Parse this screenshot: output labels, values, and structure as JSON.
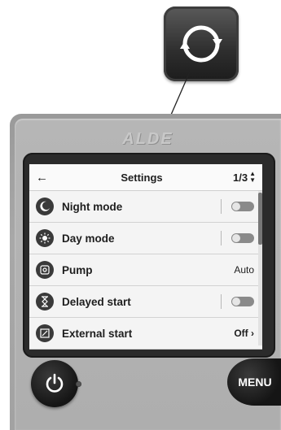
{
  "callout": {
    "icon": "refresh-icon"
  },
  "device": {
    "brand": "ALDE"
  },
  "screen": {
    "back_icon": "←",
    "title": "Settings",
    "page_indicator": "1/3",
    "page_arrows": "▲▼",
    "rows": [
      {
        "label": "Night mode",
        "icon": "moon-icon",
        "control": "toggle",
        "state": "off"
      },
      {
        "label": "Day mode",
        "icon": "sun-icon",
        "control": "toggle",
        "state": "off"
      },
      {
        "label": "Pump",
        "icon": "pump-icon",
        "control": "value",
        "value": "Auto"
      },
      {
        "label": "Delayed start",
        "icon": "hourglass-icon",
        "control": "toggle",
        "state": "off"
      },
      {
        "label": "External start",
        "icon": "external-start-icon",
        "control": "value",
        "value": "Off ›"
      }
    ]
  },
  "buttons": {
    "menu_label": "MENU",
    "power_icon": "power-icon"
  },
  "colors": {
    "screen_bg": "#f2f2f2",
    "device": "#a8a8a8",
    "button": "#1a1a1a"
  }
}
